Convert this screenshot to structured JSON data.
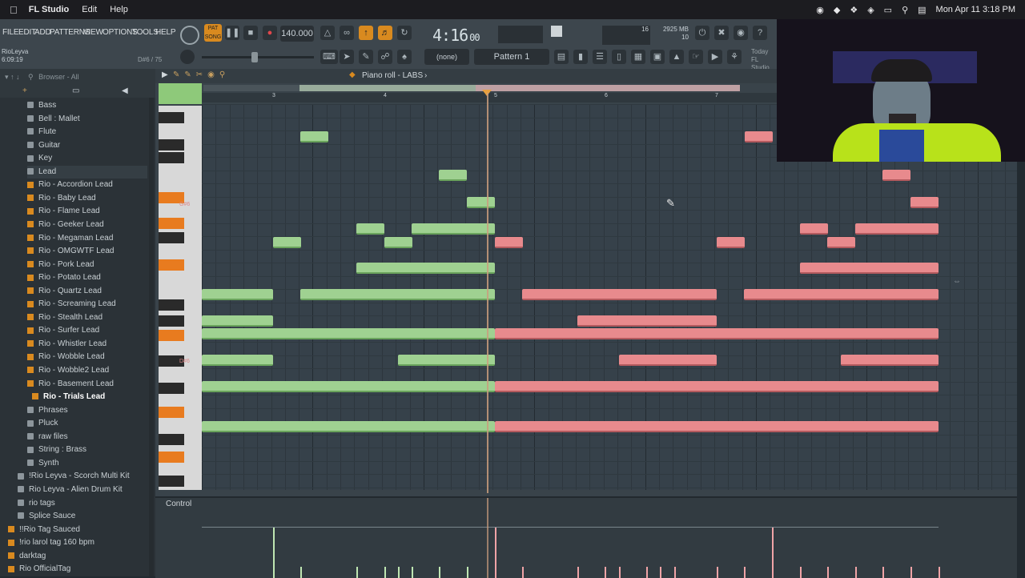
{
  "menubar": {
    "app_name": "FL Studio",
    "menus": [
      "Edit",
      "Help"
    ],
    "datetime": "Mon Apr 11  3:18 PM"
  },
  "toolbar": {
    "menu": [
      "FILE",
      "EDIT",
      "ADD",
      "PATTERNS",
      "VIEW",
      "OPTIONS",
      "TOOLS",
      "HELP"
    ],
    "pat_label": "PAT",
    "song_label": "SONG",
    "tempo": "140.000",
    "time": "4:16",
    "time_ms": "00",
    "cpu_voices": "16",
    "memory": "2925 MB",
    "memory_sub": "10",
    "pattern_name": "Pattern 1",
    "none_label": "(none)",
    "hint_title": "RioLeyva",
    "hint_time": "6:09:19",
    "hint_note": "D#6 / 75",
    "today_label": "Today",
    "fl_label": "FL Studio"
  },
  "browser": {
    "header": "Browser - All",
    "items": [
      {
        "label": "Bass",
        "type": "folder",
        "indent": 1
      },
      {
        "label": "Bell : Mallet",
        "type": "folder",
        "indent": 1
      },
      {
        "label": "Flute",
        "type": "folder",
        "indent": 1
      },
      {
        "label": "Guitar",
        "type": "folder",
        "indent": 1
      },
      {
        "label": "Key",
        "type": "folder",
        "indent": 1
      },
      {
        "label": "Lead",
        "type": "folder",
        "indent": 1
      },
      {
        "label": "Rio - Accordion Lead",
        "type": "file",
        "indent": 2
      },
      {
        "label": "Rio - Baby Lead",
        "type": "file",
        "indent": 2
      },
      {
        "label": "Rio - Flame Lead",
        "type": "file",
        "indent": 2
      },
      {
        "label": "Rio - Geeker Lead",
        "type": "file",
        "indent": 2
      },
      {
        "label": "Rio - Megaman Lead",
        "type": "file",
        "indent": 2
      },
      {
        "label": "Rio - OMGWTF Lead",
        "type": "file",
        "indent": 2
      },
      {
        "label": "Rio - Pork Lead",
        "type": "file",
        "indent": 2
      },
      {
        "label": "Rio - Potato Lead",
        "type": "file",
        "indent": 2
      },
      {
        "label": "Rio - Quartz Lead",
        "type": "file",
        "indent": 2
      },
      {
        "label": "Rio - Screaming Lead",
        "type": "file",
        "indent": 2
      },
      {
        "label": "Rio - Stealth Lead",
        "type": "file",
        "indent": 2
      },
      {
        "label": "Rio - Surfer Lead",
        "type": "file",
        "indent": 2
      },
      {
        "label": "Rio - Whistler Lead",
        "type": "file",
        "indent": 2
      },
      {
        "label": "Rio - Wobble Lead",
        "type": "file",
        "indent": 2
      },
      {
        "label": "Rio - Wobble2 Lead",
        "type": "file",
        "indent": 2
      },
      {
        "label": "Rio - Basement Lead",
        "type": "file",
        "indent": 2
      },
      {
        "label": "Rio - Trials Lead",
        "type": "file",
        "indent": 3,
        "selected": true
      },
      {
        "label": "Phrases",
        "type": "folder",
        "indent": 1
      },
      {
        "label": "Pluck",
        "type": "folder",
        "indent": 1
      },
      {
        "label": "raw files",
        "type": "folder",
        "indent": 1
      },
      {
        "label": "String : Brass",
        "type": "folder",
        "indent": 1
      },
      {
        "label": "Synth",
        "type": "folder",
        "indent": 1
      },
      {
        "label": "!Rio Leyva - Scorch Multi Kit",
        "type": "folder",
        "indent": 0
      },
      {
        "label": "Rio Leyva - Alien Drum Kit",
        "type": "folder",
        "indent": 0
      },
      {
        "label": "rio tags",
        "type": "folder",
        "indent": 0
      },
      {
        "label": "Splice Sauce",
        "type": "folder",
        "indent": 0
      },
      {
        "label": "!!Rio Tag Sauced",
        "type": "file",
        "indent": -1
      },
      {
        "label": "!rio larol tag 160 bpm",
        "type": "file",
        "indent": -1
      },
      {
        "label": "darktag",
        "type": "file",
        "indent": -1
      },
      {
        "label": "Rio OfficialTag",
        "type": "file",
        "indent": -1
      }
    ]
  },
  "piano_roll": {
    "title": "Piano roll - LABS",
    "bar_numbers": [
      "3",
      "4",
      "5",
      "6",
      "7"
    ],
    "control_label": "Control",
    "key_labels": [
      "G#6",
      "D#6"
    ]
  },
  "colors": {
    "note_green": "#9fd191",
    "note_red": "#e88a8d",
    "accent_orange": "#d98a1f"
  }
}
